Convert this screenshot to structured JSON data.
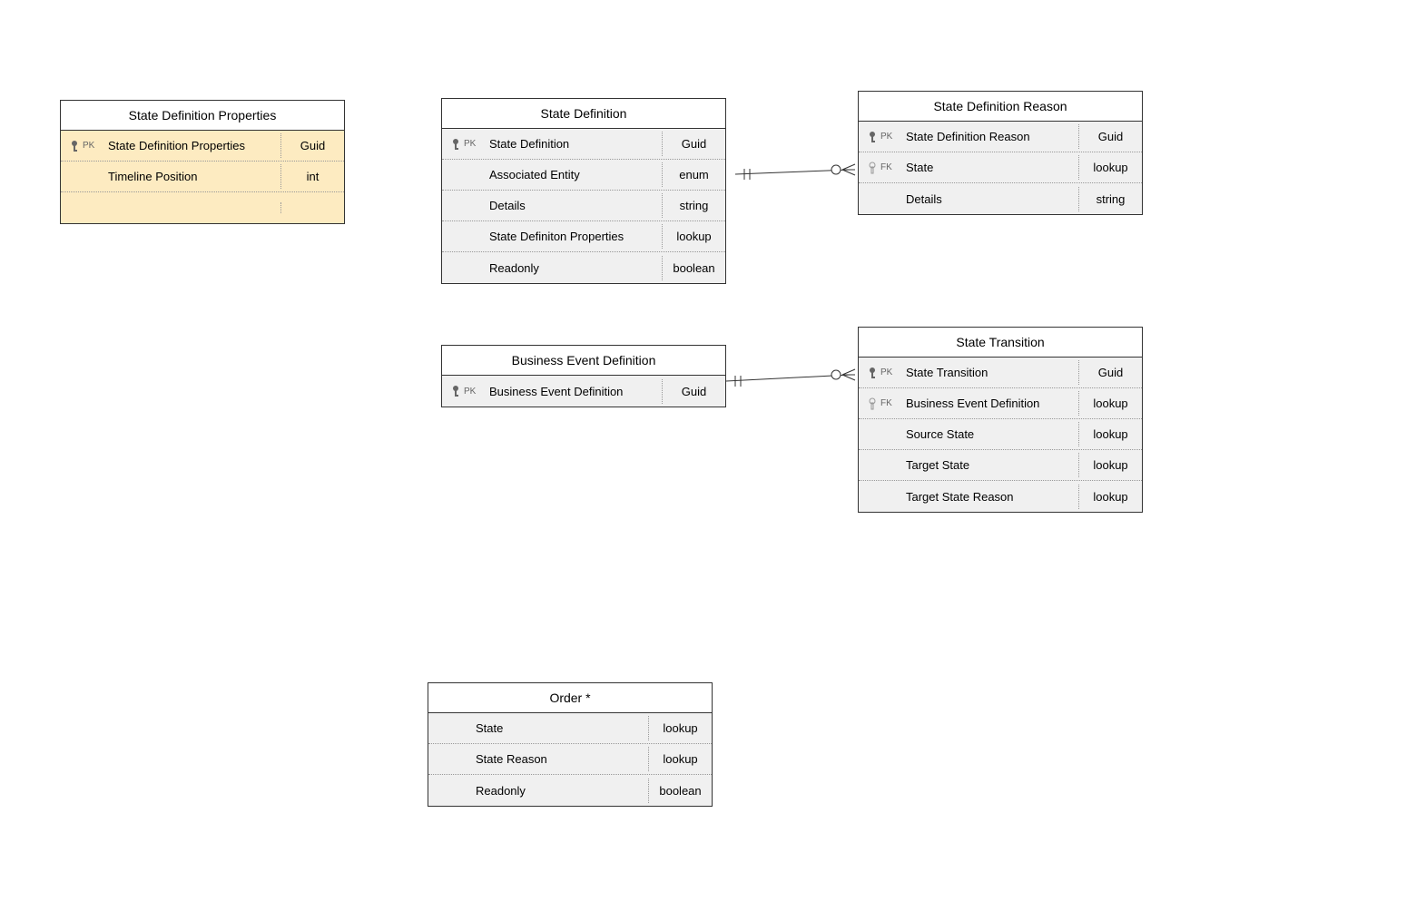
{
  "entities": {
    "stateDefProps": {
      "title": "State Definition Properties",
      "rows": [
        {
          "key": "PK",
          "name": "State Definition Properties",
          "type": "Guid",
          "filled": true
        },
        {
          "key": "",
          "name": "Timeline Position",
          "type": "int",
          "filled": false
        }
      ]
    },
    "stateDef": {
      "title": "State Definition",
      "rows": [
        {
          "key": "PK",
          "name": "State Definition",
          "type": "Guid",
          "filled": true
        },
        {
          "key": "",
          "name": "Associated Entity",
          "type": "enum",
          "filled": false
        },
        {
          "key": "",
          "name": "Details",
          "type": "string",
          "filled": false
        },
        {
          "key": "",
          "name": "State Definiton Properties",
          "type": "lookup",
          "filled": false
        },
        {
          "key": "",
          "name": "Readonly",
          "type": "boolean",
          "filled": false
        }
      ]
    },
    "stateDefReason": {
      "title": "State Definition Reason",
      "rows": [
        {
          "key": "PK",
          "name": "State Definition Reason",
          "type": "Guid",
          "filled": true
        },
        {
          "key": "FK",
          "name": "State",
          "type": "lookup",
          "filled": false
        },
        {
          "key": "",
          "name": "Details",
          "type": "string",
          "filled": false
        }
      ]
    },
    "businessEventDef": {
      "title": "Business Event Definition",
      "rows": [
        {
          "key": "PK",
          "name": "Business Event Definition",
          "type": "Guid",
          "filled": true
        }
      ]
    },
    "stateTransition": {
      "title": "State Transition",
      "rows": [
        {
          "key": "PK",
          "name": "State Transition",
          "type": "Guid",
          "filled": true
        },
        {
          "key": "FK",
          "name": "Business Event Definition",
          "type": "lookup",
          "filled": false
        },
        {
          "key": "",
          "name": "Source State",
          "type": "lookup",
          "filled": false
        },
        {
          "key": "",
          "name": "Target State",
          "type": "lookup",
          "filled": false
        },
        {
          "key": "",
          "name": "Target State Reason",
          "type": "lookup",
          "filled": false
        }
      ]
    },
    "order": {
      "title": "Order *",
      "rows": [
        {
          "key": "",
          "name": "State",
          "type": "lookup",
          "filled": false
        },
        {
          "key": "",
          "name": "State Reason",
          "type": "lookup",
          "filled": false
        },
        {
          "key": "",
          "name": "Readonly",
          "type": "boolean",
          "filled": false
        }
      ]
    }
  }
}
